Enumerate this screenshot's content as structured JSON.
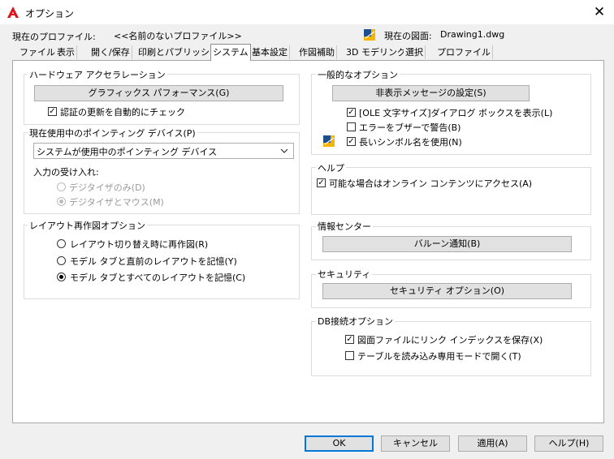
{
  "window": {
    "title": "オプション",
    "close_glyph": "✕",
    "brand_color": "#e0101a"
  },
  "profile": {
    "current_profile_label": "現在のプロファイル:",
    "current_profile_value": "<<名前のないプロファイル>>",
    "current_drawing_label": "現在の図面:",
    "current_drawing_value": "Drawing1.dwg"
  },
  "tabs": [
    {
      "label": "ファイル"
    },
    {
      "label": "表示"
    },
    {
      "label": "開く/保存"
    },
    {
      "label": "印刷とパブリッシュ"
    },
    {
      "label": "システム",
      "active": true
    },
    {
      "label": "基本設定"
    },
    {
      "label": "作図補助"
    },
    {
      "label": "3D モデリング"
    },
    {
      "label": "選択"
    },
    {
      "label": "プロファイル"
    }
  ],
  "hardware": {
    "group_label": "ハードウェア アクセラレーション",
    "graphics_button": "グラフィックス パフォーマンス(G)",
    "auto_check_label": "認証の更新を自動的にチェック",
    "auto_check": true
  },
  "pointing": {
    "group_label": "現在使用中のポインティング デバイス(P)",
    "device_value": "システムが使用中のポインティング デバイス",
    "accept_label": "入力の受け入れ:",
    "digitizer_only": "デジタイザのみ(D)",
    "digitizer_mouse": "デジタイザとマウス(M)",
    "selected": "digitizer_mouse"
  },
  "layout_regen": {
    "group_label": "レイアウト再作図オプション",
    "option1": "レイアウト切り替え時に再作図(R)",
    "option2": "モデル タブと直前のレイアウトを記憶(Y)",
    "option3": "モデル タブとすべてのレイアウトを記憶(C)",
    "selected": "option3"
  },
  "general": {
    "group_label": "一般的なオプション",
    "hidden_messages_button": "非表示メッセージの設定(S)",
    "ole_label": "[OLE 文字サイズ]ダイアログ ボックスを表示(L)",
    "ole": true,
    "beep_label": "エラーをブザーで警告(B)",
    "beep": false,
    "long_names_label": "長いシンボル名を使用(N)",
    "long_names": true
  },
  "help": {
    "group_label": "ヘルプ",
    "online_label": "可能な場合はオンライン コンテンツにアクセス(A)",
    "online": true
  },
  "info_center": {
    "group_label": "情報センター",
    "balloon_button": "バルーン通知(B)"
  },
  "security": {
    "group_label": "セキュリティ",
    "security_button": "セキュリティ オプション(O)"
  },
  "db": {
    "group_label": "DB接続オプション",
    "link_index_label": "図面ファイルにリンク インデックスを保存(X)",
    "link_index": true,
    "readonly_label": "テーブルを読み込み専用モードで開く(T)",
    "readonly": false
  },
  "footer": {
    "ok": "OK",
    "cancel": "キャンセル",
    "apply": "適用(A)",
    "help": "ヘルプ(H)"
  }
}
